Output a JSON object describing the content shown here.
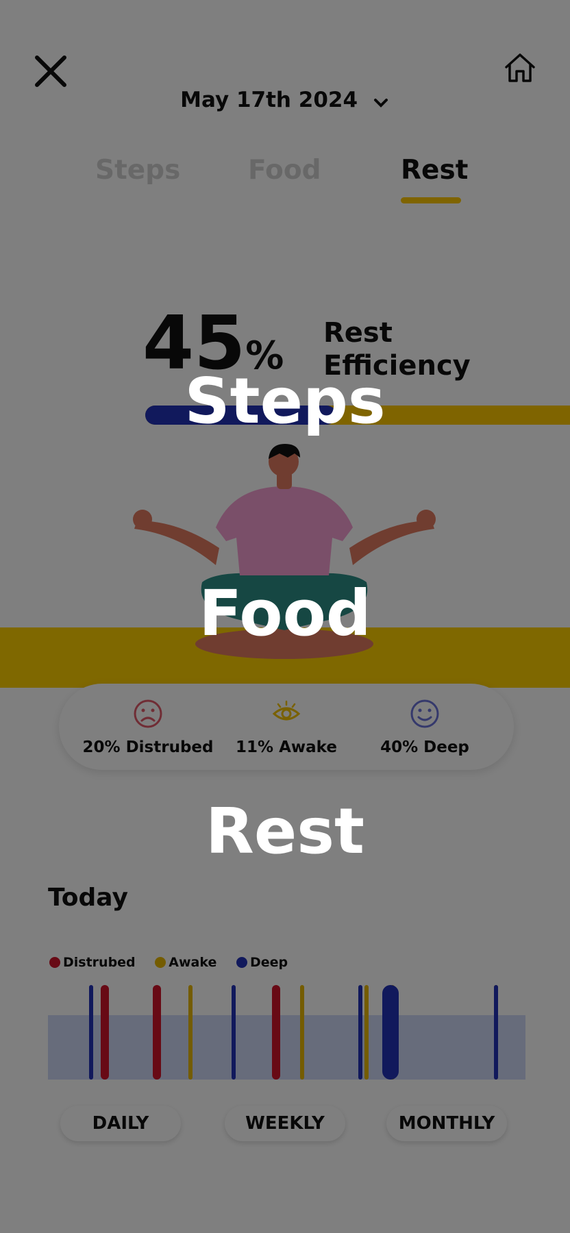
{
  "header": {
    "date_label": "May 17th 2024"
  },
  "tabs": [
    {
      "label": "Steps",
      "active": false
    },
    {
      "label": "Food",
      "active": false
    },
    {
      "label": "Rest",
      "active": true
    }
  ],
  "efficiency": {
    "value": "45",
    "unit": "%",
    "label_line1": "Rest",
    "label_line2": "Efficiency",
    "progress": 0.45
  },
  "stats": [
    {
      "label": "20% Distrubed",
      "icon": "sad-face-icon"
    },
    {
      "label": "11% Awake",
      "icon": "eye-icon"
    },
    {
      "label": "40% Deep",
      "icon": "smile-face-icon"
    }
  ],
  "today": {
    "title": "Today",
    "legend": [
      {
        "label": "Distrubed",
        "color": "#d0152a"
      },
      {
        "label": "Awake",
        "color": "#e8b900"
      },
      {
        "label": "Deep",
        "color": "#2333b8"
      }
    ]
  },
  "chart_data": {
    "type": "bar",
    "series": [
      {
        "name": "Distrubed",
        "events": [
          1,
          2,
          5
        ]
      },
      {
        "name": "Awake",
        "events": [
          3,
          6,
          8,
          9,
          11
        ]
      },
      {
        "name": "Deep",
        "events": [
          0,
          4,
          7,
          10,
          12
        ]
      }
    ]
  },
  "periods": [
    "DAILY",
    "WEEKLY",
    "MONTHLY"
  ],
  "overlay_menu": {
    "items": [
      "Steps",
      "Food",
      "Rest"
    ]
  },
  "colors": {
    "accent_yellow": "#ffc800",
    "deep_blue": "#2333b8",
    "disturbed_red": "#d0152a",
    "awake_yellow": "#e8b900",
    "overlay": "rgba(0,0,0,0.5)"
  }
}
